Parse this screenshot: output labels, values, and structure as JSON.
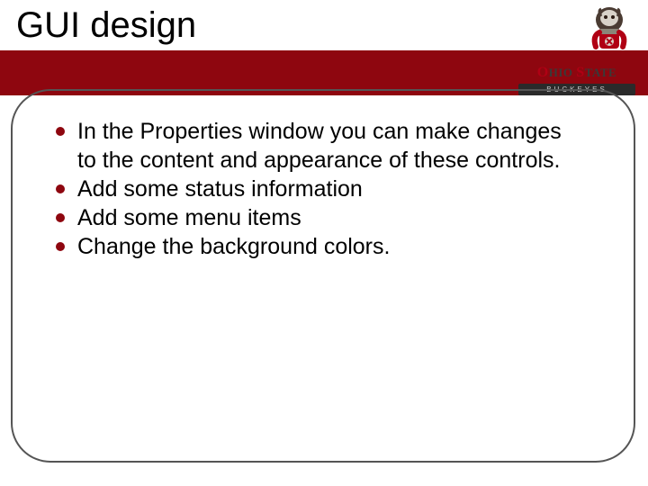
{
  "title": "GUI design",
  "logo": {
    "line1": "OHIO STATE",
    "line2": "BUCKEYES"
  },
  "bullets": [
    "In the Properties window you can make changes to the content and appearance of these controls.",
    "Add some status information",
    "Add some menu items",
    "Change the background colors."
  ]
}
